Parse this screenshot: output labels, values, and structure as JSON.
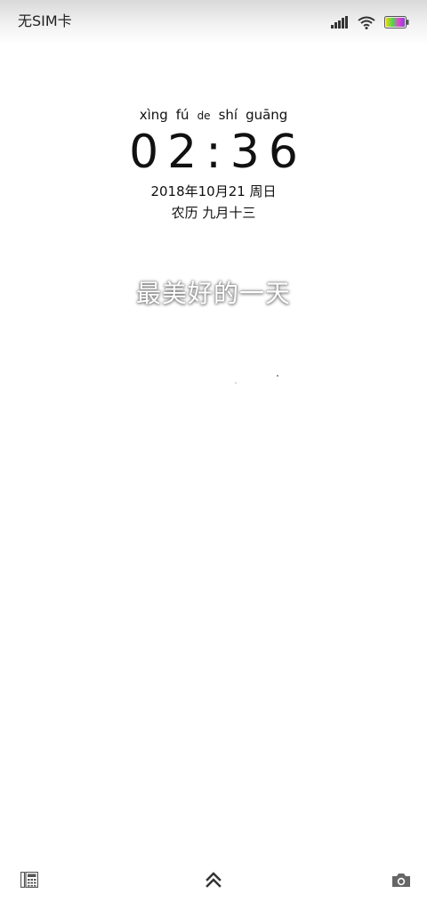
{
  "status_bar": {
    "carrier": "无SIM卡",
    "icons": [
      "signal-icon",
      "wifi-icon",
      "battery-icon"
    ]
  },
  "clock": {
    "pinyin": [
      "xìng",
      "fú",
      "de",
      "shí",
      "guāng"
    ],
    "time": "02:36",
    "date": "2018年10月21 周日",
    "lunar": "农历 九月十三"
  },
  "slogan": "最美好的一天",
  "bottom_bar": {
    "left_icon": "phone-dialer-icon",
    "center_icon": "double-chevron-up-icon",
    "right_icon": "camera-icon"
  },
  "colors": {
    "status_gradient_top": "#d9d9d9",
    "text": "#111111",
    "icon": "#555555"
  }
}
